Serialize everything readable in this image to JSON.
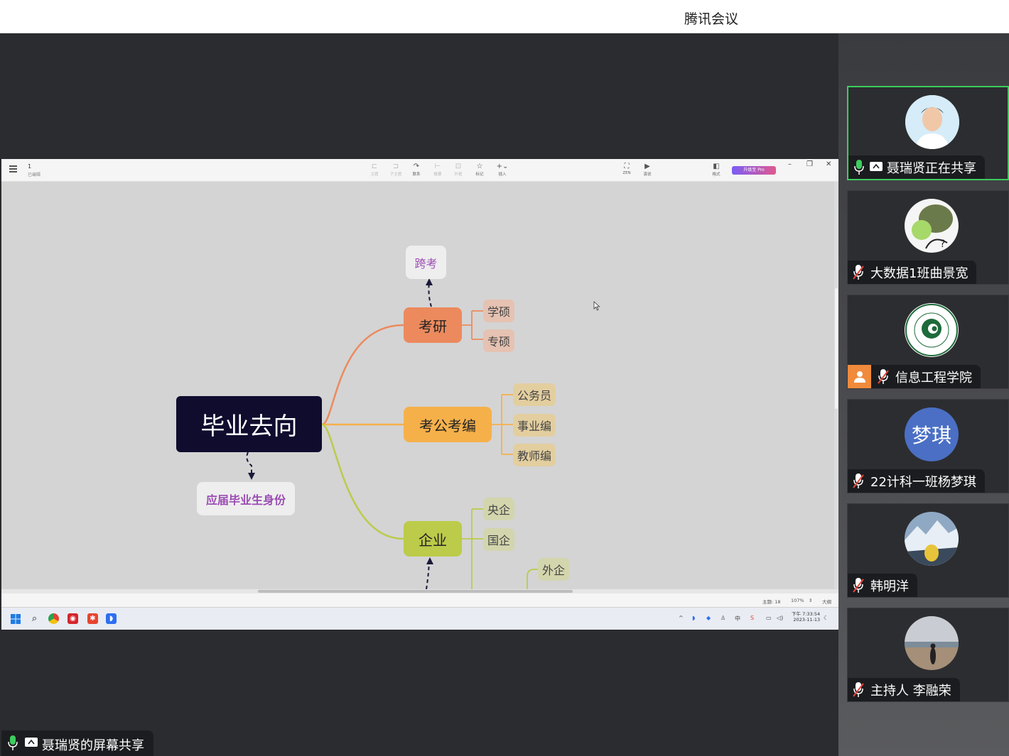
{
  "app": {
    "title": "腾讯会议"
  },
  "shared_screen": {
    "doc": {
      "name": "1",
      "status": "已编辑"
    },
    "toolbar": [
      {
        "icon": "topic-icon",
        "label": "主题",
        "enabled": false
      },
      {
        "icon": "subtopic-icon",
        "label": "子主题",
        "enabled": false
      },
      {
        "icon": "relation-icon",
        "label": "联系",
        "enabled": true
      },
      {
        "icon": "summary-icon",
        "label": "概要",
        "enabled": false
      },
      {
        "icon": "boundary-icon",
        "label": "外框",
        "enabled": false
      },
      {
        "icon": "star-icon",
        "label": "标记",
        "enabled": true
      },
      {
        "icon": "plus-icon",
        "label": "插入",
        "enabled": true
      }
    ],
    "right_tools": [
      {
        "icon": "zen-icon",
        "label": "ZEN"
      },
      {
        "icon": "present-icon",
        "label": "演说"
      },
      {
        "icon": "format-icon",
        "label": "格式"
      }
    ],
    "pro_button": "升级至 Pro",
    "mindmap": {
      "root": "毕业去向",
      "root_note": "应届毕业生身份",
      "branches": [
        {
          "label": "考研",
          "note": "跨考",
          "children": [
            "学硕",
            "专硕"
          ]
        },
        {
          "label": "考公考编",
          "children": [
            "公务员",
            "事业编",
            "教师编"
          ]
        },
        {
          "label": "企业",
          "children": [
            "央企",
            "国企",
            "外企"
          ]
        }
      ]
    },
    "statusbar": {
      "topics": "主题: 18",
      "zoom": "107%",
      "outline": "大纲"
    },
    "taskbar": {
      "clock_time": "下午 7:33:54",
      "clock_date": "2023-11-13",
      "ime": "中"
    }
  },
  "screen_share_label": "聂瑞贤的屏幕共享",
  "participants": [
    {
      "name": "聂瑞贤正在共享",
      "mic": "on",
      "sharing": true,
      "active": true
    },
    {
      "name": "大数据1班曲景宽",
      "mic": "muted"
    },
    {
      "name": "信息工程学院",
      "mic": "muted",
      "host_badge": true
    },
    {
      "name": "22计科一班杨梦琪",
      "mic": "muted",
      "avatar_text": "梦琪"
    },
    {
      "name": "韩明洋",
      "mic": "muted"
    },
    {
      "name": "主持人 李融荣",
      "mic": "muted"
    }
  ]
}
